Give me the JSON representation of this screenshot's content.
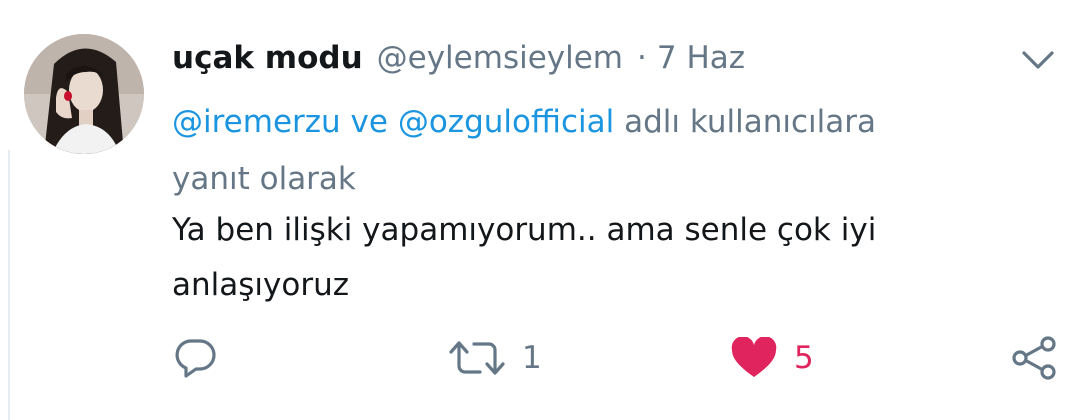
{
  "tweet": {
    "author": {
      "display_name": "uçak modu",
      "handle": "@eylemsieylem",
      "separator": "·",
      "date": "7 Haz"
    },
    "reply_context": {
      "mentions": [
        "@iremerzu",
        "@ozgulofficial"
      ],
      "connector": "ve",
      "suffix_line1": "adlı kullanıcılara",
      "suffix_line2": "yanıt olarak"
    },
    "text_line1": "Ya ben ilişki yapamıyorum.. ama senle çok iyi",
    "text_line2": "anlaşıyoruz",
    "actions": {
      "reply_count": "",
      "retweet_count": "1",
      "like_count": "5",
      "liked": true
    }
  },
  "icons": {
    "caret": "chevron-down-icon",
    "reply": "reply-icon",
    "retweet": "retweet-icon",
    "like": "heart-icon",
    "share": "share-icon"
  },
  "colors": {
    "name": "#14171a",
    "meta": "#657786",
    "link": "#1b95e0",
    "like": "#e0245e"
  }
}
